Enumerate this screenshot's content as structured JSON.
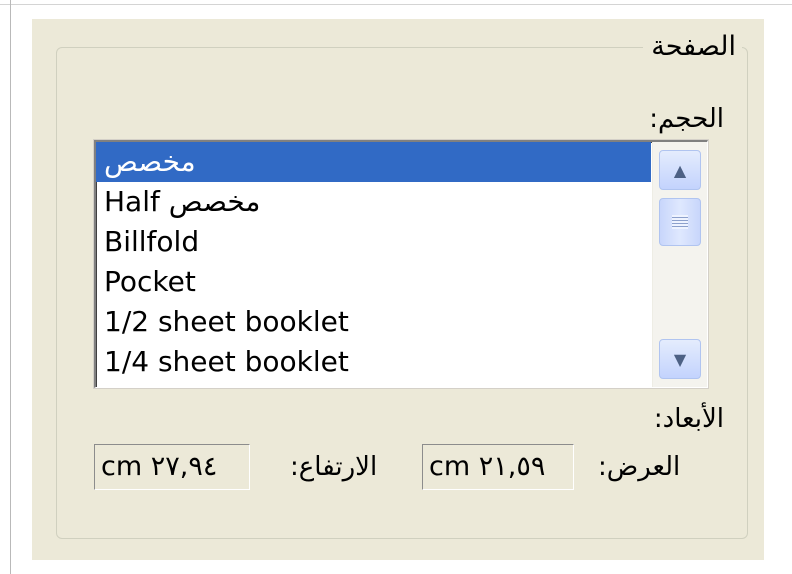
{
  "group": {
    "title": "الصفحة"
  },
  "size": {
    "label": "الحجم:",
    "items": [
      {
        "text": "مخصص",
        "selected": true
      },
      {
        "text": "مخصص Half",
        "selected": false
      },
      {
        "text": "Billfold",
        "selected": false
      },
      {
        "text": "Pocket",
        "selected": false
      },
      {
        "text": "1/2 sheet booklet",
        "selected": false
      },
      {
        "text": "1/4 sheet booklet",
        "selected": false
      }
    ]
  },
  "scrollbar": {
    "up_icon": "▲",
    "down_icon": "▼"
  },
  "dimensions": {
    "label": "الأبعاد:",
    "width_label": "العرض:",
    "width_value": "cm ٢١,٥٩",
    "height_label": "الارتفاع:",
    "height_value": "cm ٢٧,٩٤"
  },
  "colors": {
    "panel": "#ece9d8",
    "selection": "#316ac5"
  }
}
